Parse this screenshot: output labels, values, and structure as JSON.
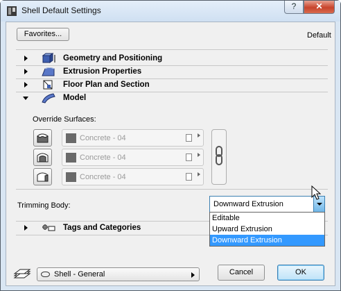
{
  "window": {
    "title": "Shell Default Settings",
    "help_label": "?",
    "close_label": "✕"
  },
  "header": {
    "favorites_label": "Favorites...",
    "default_label": "Default"
  },
  "panels": [
    {
      "label": "Geometry and Positioning",
      "icon": "geometry-icon",
      "expanded": false
    },
    {
      "label": "Extrusion Properties",
      "icon": "extrusion-icon",
      "expanded": false
    },
    {
      "label": "Floor Plan and Section",
      "icon": "floor-plan-icon",
      "expanded": false
    },
    {
      "label": "Model",
      "icon": "model-icon",
      "expanded": true
    }
  ],
  "model": {
    "override_label": "Override Surfaces:",
    "surfaces": [
      {
        "material": "Concrete - 04"
      },
      {
        "material": "Concrete - 04"
      },
      {
        "material": "Concrete - 04"
      }
    ]
  },
  "trimming": {
    "label": "Trimming Body:",
    "selected": "Downward Extrusion",
    "options": [
      "Editable",
      "Upward Extrusion",
      "Downward Extrusion"
    ]
  },
  "tags_panel": {
    "label": "Tags and Categories",
    "icon": "tags-icon",
    "expanded": false
  },
  "footer": {
    "profile_label": "Shell - General",
    "cancel_label": "Cancel",
    "ok_label": "OK"
  },
  "colors": {
    "accent": "#3399ff",
    "title_bg": "#d9e6f3",
    "close_red": "#c8442c"
  }
}
